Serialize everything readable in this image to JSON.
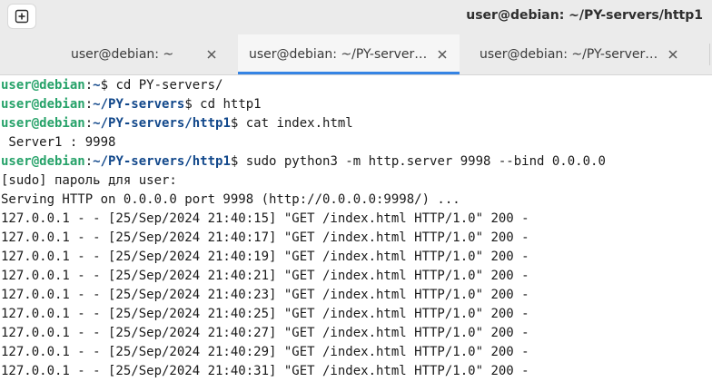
{
  "window": {
    "title": "user@debian: ~/PY-servers/http1"
  },
  "tabs": [
    {
      "label": "user@debian: ~",
      "active": false
    },
    {
      "label": "user@debian: ~/PY-server…",
      "active": true
    },
    {
      "label": "user@debian: ~/PY-server…",
      "active": false
    }
  ],
  "icons": {
    "new_tab": "new-tab-icon",
    "close": "close-icon"
  },
  "colors": {
    "prompt_user": "#26a269",
    "prompt_path": "#12488b",
    "active_tab_indicator": "#3584e4"
  },
  "terminal": {
    "prompts": [
      {
        "user": "user@debian",
        "sep": ":",
        "path": "~",
        "end": "$ ",
        "cmd": "cd PY-servers/"
      },
      {
        "user": "user@debian",
        "sep": ":",
        "path": "~/PY-servers",
        "end": "$ ",
        "cmd": "cd http1"
      },
      {
        "user": "user@debian",
        "sep": ":",
        "path": "~/PY-servers/http1",
        "end": "$ ",
        "cmd": "cat index.html"
      }
    ],
    "cat_output": " Server1 : 9998",
    "server_prompt": {
      "user": "user@debian",
      "sep": ":",
      "path": "~/PY-servers/http1",
      "end": "$ ",
      "cmd": "sudo python3 -m http.server 9998 --bind 0.0.0.0"
    },
    "sudo_line": "[sudo] пароль для user:",
    "serving_line": "Serving HTTP on 0.0.0.0 port 9998 (http://0.0.0.0:9998/) ...",
    "log_lines": [
      "127.0.0.1 - - [25/Sep/2024 21:40:15] \"GET /index.html HTTP/1.0\" 200 -",
      "127.0.0.1 - - [25/Sep/2024 21:40:17] \"GET /index.html HTTP/1.0\" 200 -",
      "127.0.0.1 - - [25/Sep/2024 21:40:19] \"GET /index.html HTTP/1.0\" 200 -",
      "127.0.0.1 - - [25/Sep/2024 21:40:21] \"GET /index.html HTTP/1.0\" 200 -",
      "127.0.0.1 - - [25/Sep/2024 21:40:23] \"GET /index.html HTTP/1.0\" 200 -",
      "127.0.0.1 - - [25/Sep/2024 21:40:25] \"GET /index.html HTTP/1.0\" 200 -",
      "127.0.0.1 - - [25/Sep/2024 21:40:27] \"GET /index.html HTTP/1.0\" 200 -",
      "127.0.0.1 - - [25/Sep/2024 21:40:29] \"GET /index.html HTTP/1.0\" 200 -",
      "127.0.0.1 - - [25/Sep/2024 21:40:31] \"GET /index.html HTTP/1.0\" 200 -"
    ]
  }
}
